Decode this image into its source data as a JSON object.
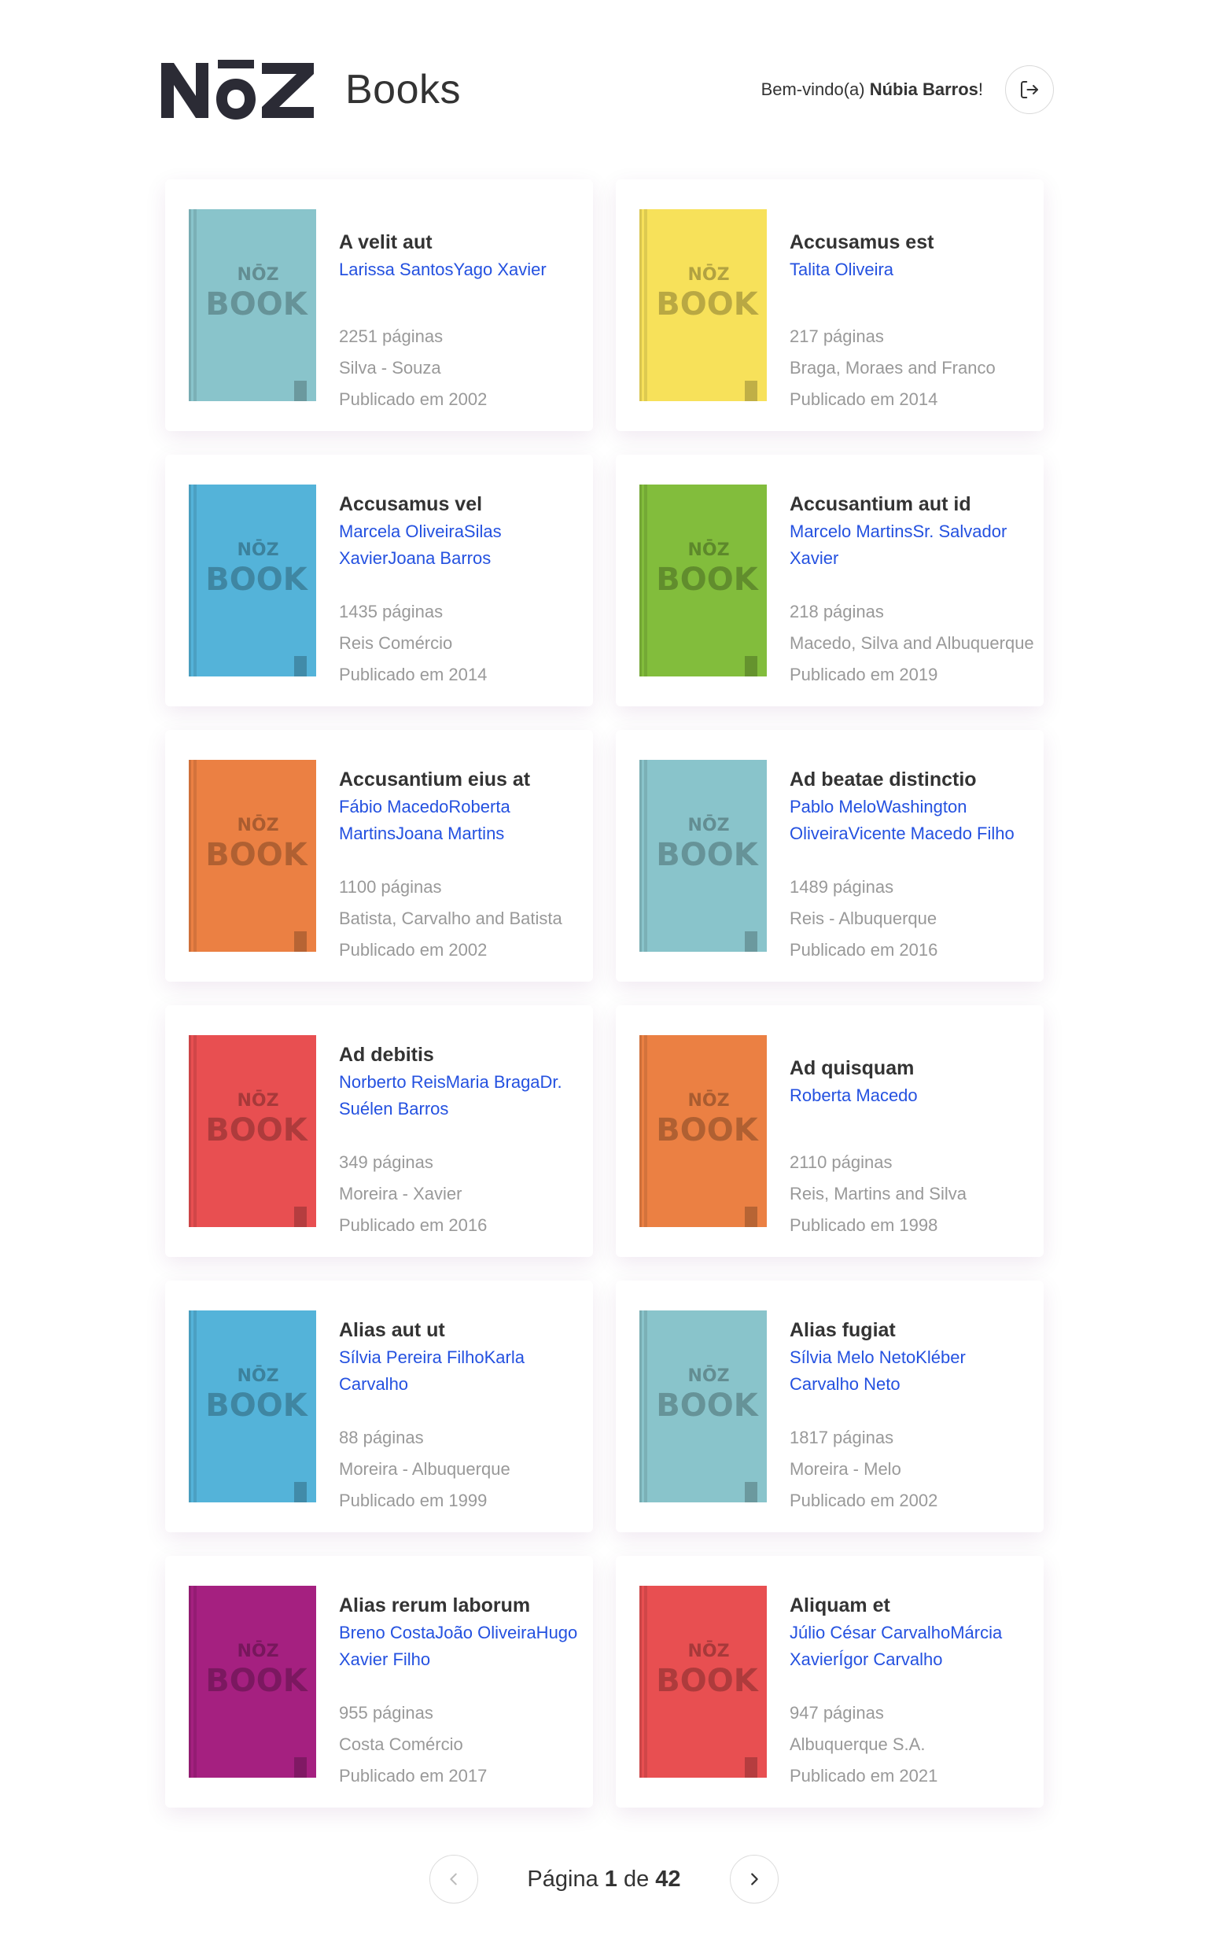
{
  "header": {
    "logo_text": "NoZ",
    "brand_title": "Books",
    "welcome_prefix": "Bem-vindo(a) ",
    "user_name": "Núbia Barros",
    "welcome_suffix": "!"
  },
  "cover_label": {
    "top": "NŌZ",
    "bottom": "BOOK"
  },
  "books": [
    {
      "title": "A velit aut",
      "authors": "Larissa SantosYago Xavier",
      "pages": "2251 páginas",
      "publisher": "Silva - Souza",
      "published": "Publicado em 2002",
      "color": "#89c4cb"
    },
    {
      "title": "Accusamus est",
      "authors": "Talita Oliveira",
      "pages": "217 páginas",
      "publisher": "Braga, Moraes and Franco",
      "published": "Publicado em 2014",
      "color": "#f7e15a"
    },
    {
      "title": "Accusamus vel",
      "authors": "Marcela OliveiraSilas XavierJoana Barros",
      "pages": "1435 páginas",
      "publisher": "Reis Comércio",
      "published": "Publicado em 2014",
      "color": "#54b3d9"
    },
    {
      "title": "Accusantium aut id",
      "authors": "Marcelo MartinsSr. Salvador Xavier",
      "pages": "218 páginas",
      "publisher": "Macedo, Silva and Albuquerque",
      "published": "Publicado em 2019",
      "color": "#82bd3c"
    },
    {
      "title": "Accusantium eius at",
      "authors": "Fábio MacedoRoberta MartinsJoana Martins",
      "pages": "1100 páginas",
      "publisher": "Batista, Carvalho and Batista",
      "published": "Publicado em 2002",
      "color": "#eb8043"
    },
    {
      "title": "Ad beatae distinctio",
      "authors": "Pablo MeloWashington OliveiraVicente Macedo Filho",
      "pages": "1489 páginas",
      "publisher": "Reis - Albuquerque",
      "published": "Publicado em 2016",
      "color": "#89c4cb"
    },
    {
      "title": "Ad debitis",
      "authors": "Norberto ReisMaria BragaDr. Suélen Barros",
      "pages": "349 páginas",
      "publisher": "Moreira - Xavier",
      "published": "Publicado em 2016",
      "color": "#e84f51"
    },
    {
      "title": "Ad quisquam",
      "authors": "Roberta Macedo",
      "pages": "2110 páginas",
      "publisher": "Reis, Martins and Silva",
      "published": "Publicado em 1998",
      "color": "#eb8043"
    },
    {
      "title": "Alias aut ut",
      "authors": "Sílvia Pereira FilhoKarla Carvalho",
      "pages": "88 páginas",
      "publisher": "Moreira - Albuquerque",
      "published": "Publicado em 1999",
      "color": "#54b3d9"
    },
    {
      "title": "Alias fugiat",
      "authors": "Sílvia Melo NetoKléber Carvalho Neto",
      "pages": "1817 páginas",
      "publisher": "Moreira - Melo",
      "published": "Publicado em 2002",
      "color": "#89c4cb"
    },
    {
      "title": "Alias rerum laborum",
      "authors": "Breno CostaJoão OliveiraHugo Xavier Filho",
      "pages": "955 páginas",
      "publisher": "Costa Comércio",
      "published": "Publicado em 2017",
      "color": "#a52080"
    },
    {
      "title": "Aliquam et",
      "authors": "Júlio César CarvalhoMárcia XavierÍgor Carvalho",
      "pages": "947 páginas",
      "publisher": "Albuquerque S.A.",
      "published": "Publicado em 2021",
      "color": "#e84f51"
    }
  ],
  "pagination": {
    "prefix": "Página ",
    "current": "1",
    "separator": " de ",
    "total": "42"
  }
}
